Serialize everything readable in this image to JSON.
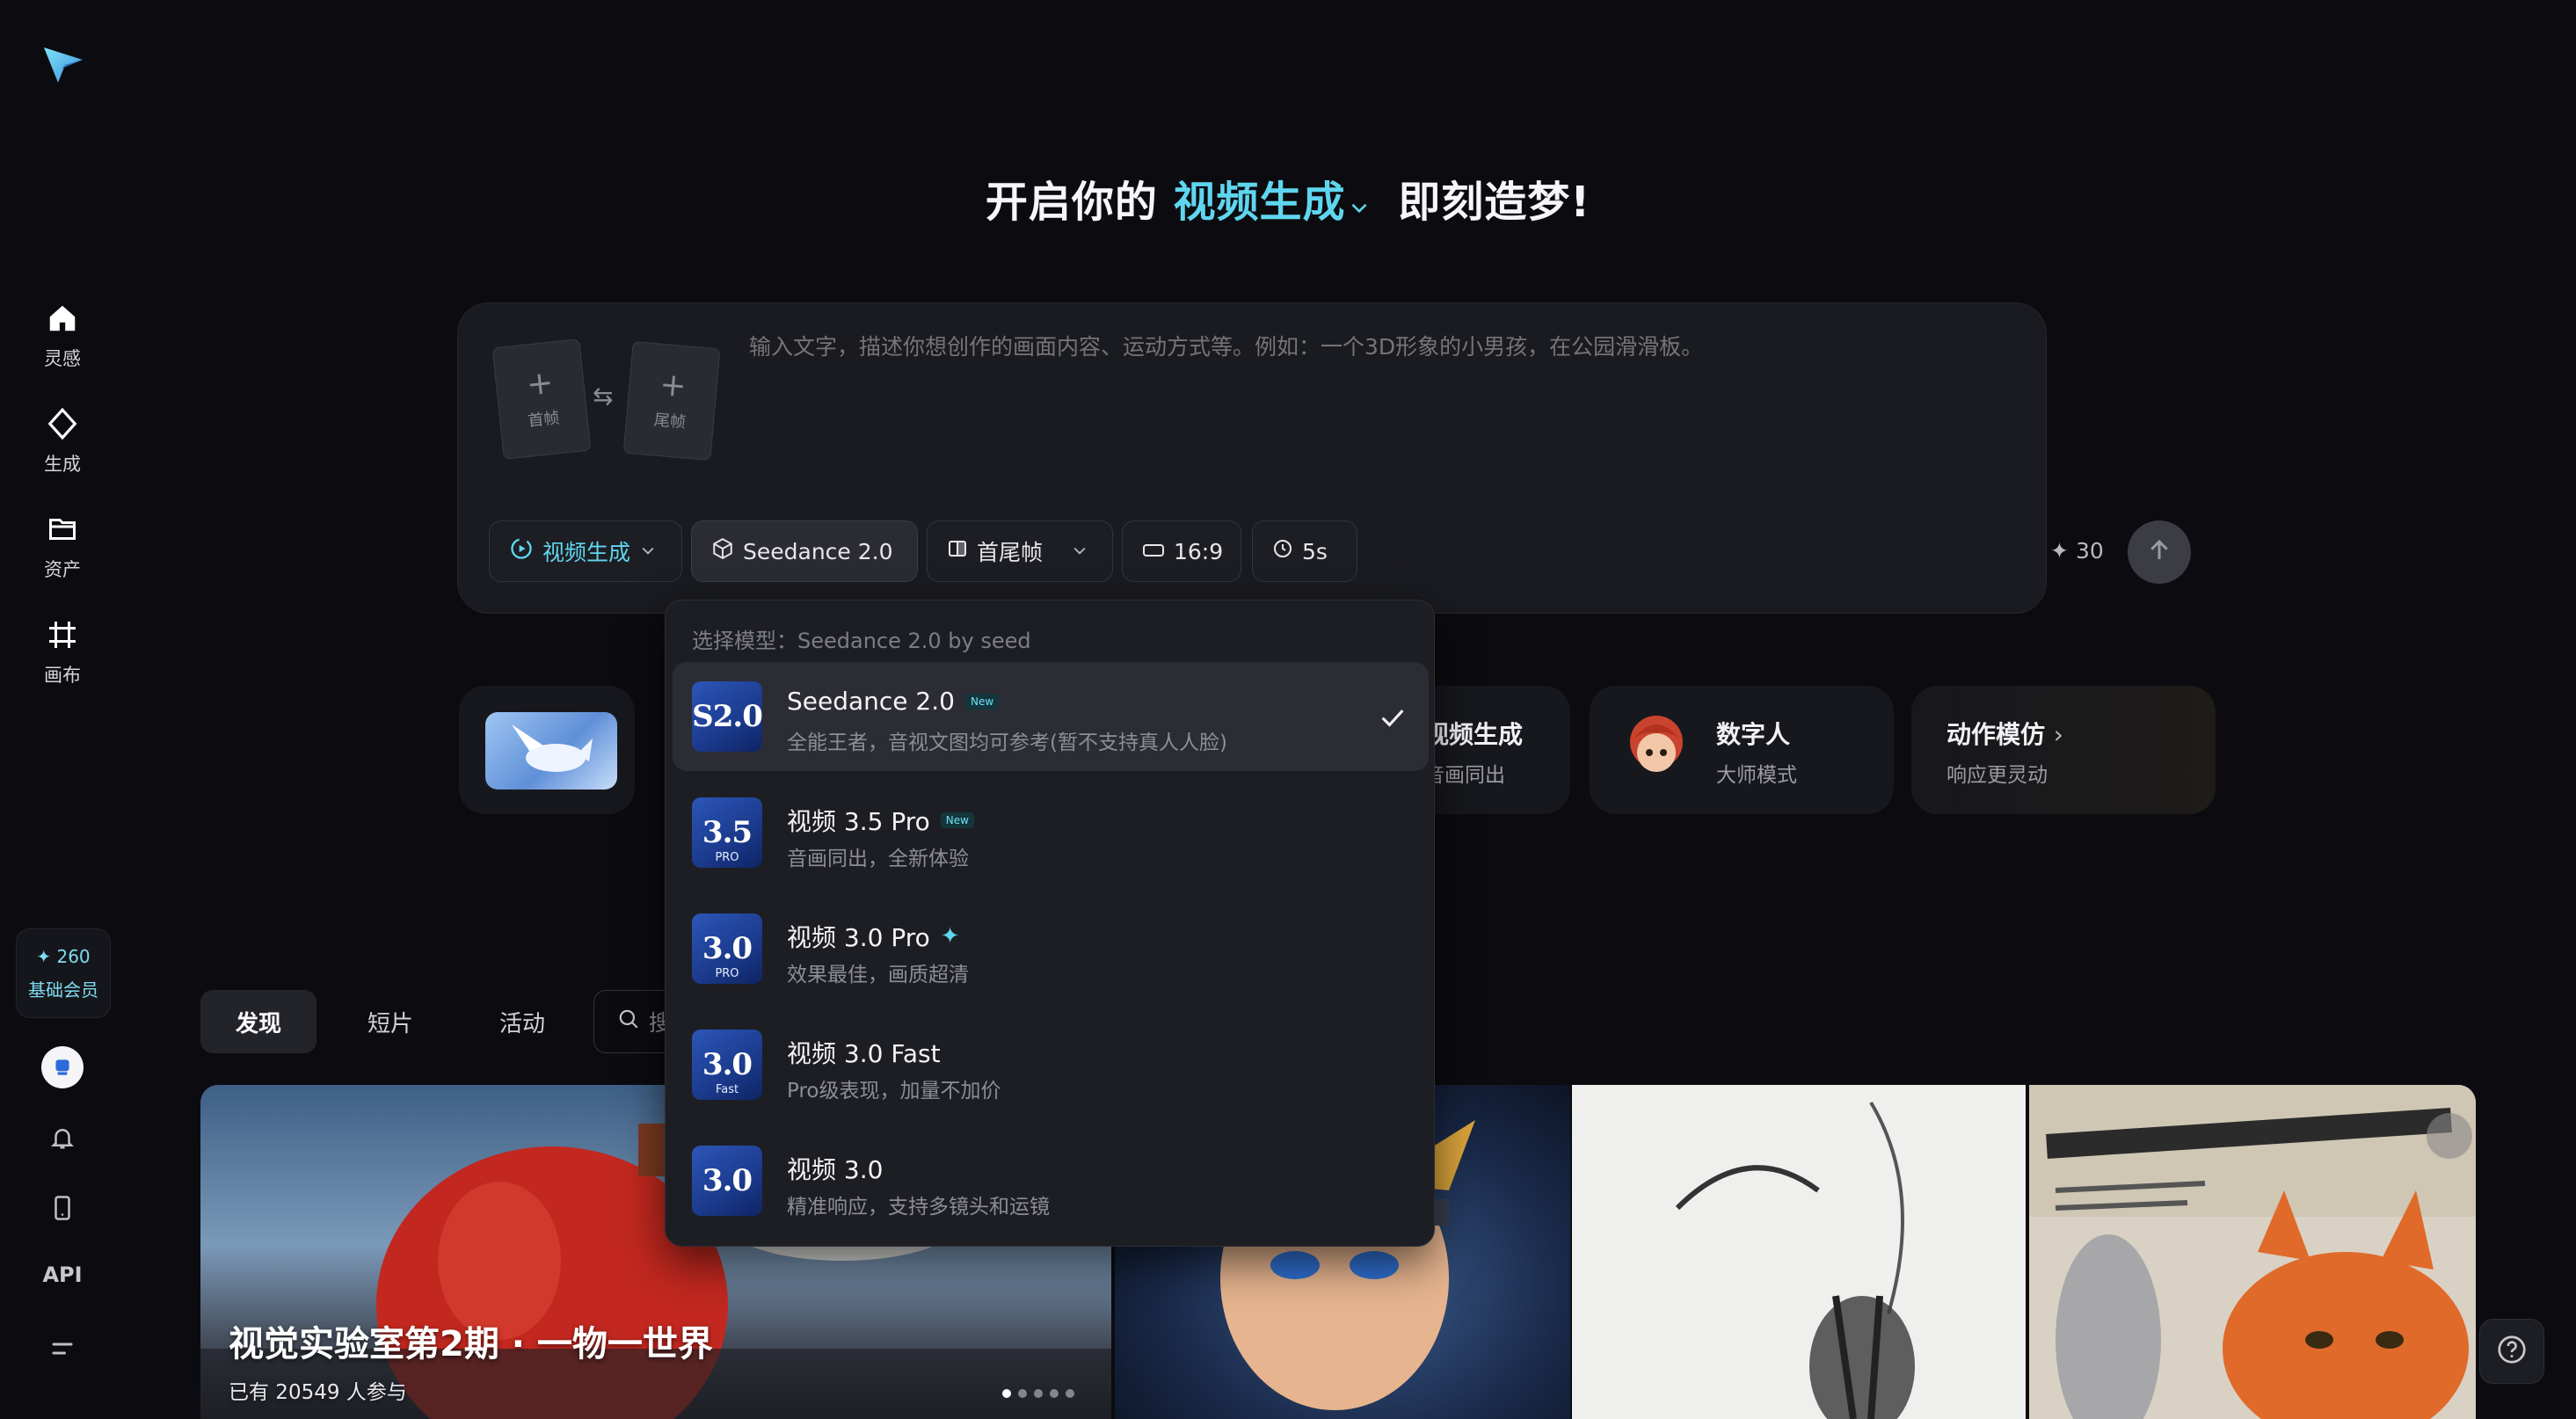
{
  "hero": {
    "prefix": "开启你的",
    "mode": "视频生成",
    "suffix": "即刻造梦!"
  },
  "sidebar": {
    "items": [
      {
        "label": "灵感",
        "icon": "home-icon"
      },
      {
        "label": "生成",
        "icon": "diamond-icon"
      },
      {
        "label": "资产",
        "icon": "folder-icon"
      },
      {
        "label": "画布",
        "icon": "canvas-icon"
      }
    ],
    "member": {
      "points": "260",
      "level": "基础会员"
    },
    "api_label": "API"
  },
  "prompt": {
    "first_frame": "首帧",
    "last_frame": "尾帧",
    "placeholder": "输入文字，描述你想创作的画面内容、运动方式等。例如：一个3D形象的小男孩，在公园滑滑板。"
  },
  "toolbar": {
    "mode_label": "视频生成",
    "model_label": "Seedance 2.0",
    "frame_mode_label": "首尾帧",
    "ratio_label": "16:9",
    "duration_label": "5s",
    "credits": "30"
  },
  "dropdown": {
    "header": "选择模型：Seedance 2.0 by seed",
    "models": [
      {
        "name": "Seedance 2.0",
        "badge": "New",
        "desc": "全能王者，音视文图均可参考(暂不支持真人人脸)",
        "thumb": "S2.0",
        "thumb_sub": "",
        "selected": true
      },
      {
        "name": "视频 3.5 Pro",
        "badge": "New",
        "desc": "音画同出，全新体验",
        "thumb": "3.5",
        "thumb_sub": "PRO",
        "selected": false
      },
      {
        "name": "视频 3.0 Pro",
        "badge": "",
        "desc": "效果最佳，画质超清",
        "thumb": "3.0",
        "thumb_sub": "PRO",
        "selected": false
      },
      {
        "name": "视频 3.0 Fast",
        "badge": "",
        "desc": "Pro级表现，加量不加价",
        "thumb": "3.0",
        "thumb_sub": "Fast",
        "selected": false
      },
      {
        "name": "视频 3.0",
        "badge": "",
        "desc": "精准响应，支持多镜头和运镜",
        "thumb": "3.0",
        "thumb_sub": "",
        "selected": false
      }
    ]
  },
  "features": {
    "hidden_card": {
      "title": "视频生成",
      "sub": "音画同出"
    },
    "digital_human": {
      "title": "数字人",
      "sub": "大师模式"
    },
    "motion": {
      "title": "动作模仿",
      "sub": "响应更灵动"
    }
  },
  "tabs": [
    "发现",
    "短片",
    "活动"
  ],
  "search": {
    "placeholder": "搜"
  },
  "banner": {
    "title": "视觉实验室第2期 · 一物一世界",
    "sub": "已有 20549 人参与"
  },
  "colors": {
    "accent": "#5fd6ef",
    "background": "#0c0c10",
    "panel": "#1a1b20"
  }
}
